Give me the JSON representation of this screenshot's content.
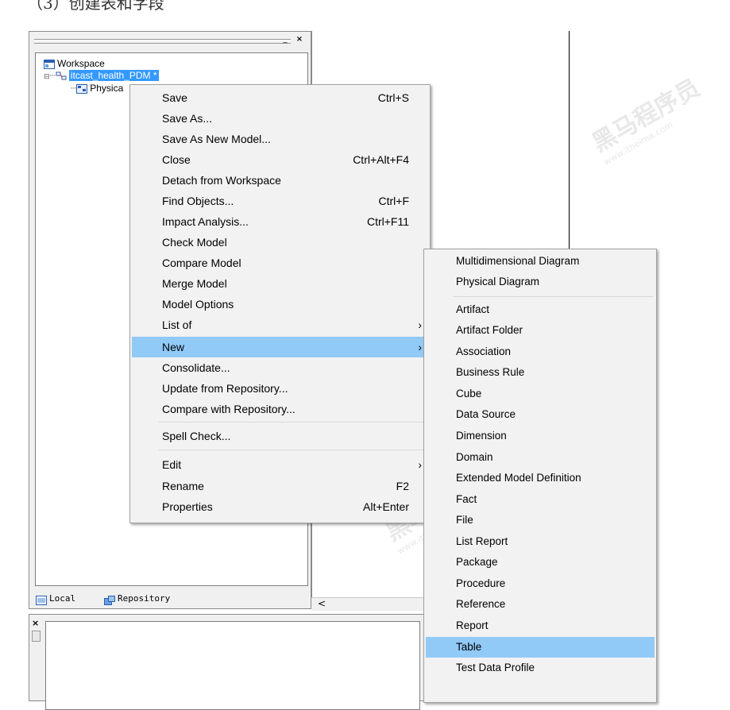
{
  "caption": "（3）创建表和字段",
  "panel": {
    "min_btn": "_",
    "max_btn": "▫",
    "close_btn": "×",
    "tree": {
      "root": "Workspace",
      "model": "itcast_health_PDM *",
      "child": "Physica"
    },
    "tabs": [
      {
        "label": "Local"
      },
      {
        "label": "Repository"
      }
    ]
  },
  "canvas": {
    "scroll_left": "<"
  },
  "output_close": "×",
  "context_menu": {
    "items": [
      {
        "label": "Save",
        "shortcut": "Ctrl+S"
      },
      {
        "label": "Save As...",
        "shortcut": ""
      },
      {
        "label": "Save As New Model...",
        "shortcut": ""
      },
      {
        "label": "Close",
        "shortcut": "Ctrl+Alt+F4"
      },
      {
        "label": "Detach from Workspace",
        "shortcut": ""
      },
      {
        "label": "Find Objects...",
        "shortcut": "Ctrl+F"
      },
      {
        "label": "Impact Analysis...",
        "shortcut": "Ctrl+F11"
      },
      {
        "label": "Check Model",
        "shortcut": ""
      },
      {
        "label": "Compare Model",
        "shortcut": ""
      },
      {
        "label": "Merge Model",
        "shortcut": ""
      },
      {
        "label": "Model Options",
        "shortcut": ""
      },
      {
        "label": "List of",
        "shortcut": "",
        "submenu": true
      },
      {
        "label": "New",
        "shortcut": "",
        "submenu": true,
        "highlighted": true
      },
      {
        "label": "Consolidate...",
        "shortcut": ""
      },
      {
        "label": "Update from Repository...",
        "shortcut": ""
      },
      {
        "label": "Compare with Repository...",
        "shortcut": ""
      },
      {
        "label": "Spell Check...",
        "shortcut": ""
      },
      {
        "label": "Edit",
        "shortcut": "",
        "submenu": true
      },
      {
        "label": "Rename",
        "shortcut": "F2"
      },
      {
        "label": "Properties",
        "shortcut": "Alt+Enter"
      }
    ]
  },
  "new_submenu": {
    "items": [
      {
        "label": "Multidimensional Diagram"
      },
      {
        "label": "Physical Diagram"
      },
      {
        "label": "Artifact"
      },
      {
        "label": "Artifact Folder"
      },
      {
        "label": "Association"
      },
      {
        "label": "Business Rule"
      },
      {
        "label": "Cube"
      },
      {
        "label": "Data Source"
      },
      {
        "label": "Dimension"
      },
      {
        "label": "Domain"
      },
      {
        "label": "Extended Model Definition"
      },
      {
        "label": "Fact"
      },
      {
        "label": "File"
      },
      {
        "label": "List Report"
      },
      {
        "label": "Package"
      },
      {
        "label": "Procedure"
      },
      {
        "label": "Reference"
      },
      {
        "label": "Report"
      },
      {
        "label": "Table",
        "highlighted": true
      },
      {
        "label": "Test Data Profile"
      }
    ]
  },
  "watermark": {
    "brand": "黑马程序员",
    "url": "www.itheima.com"
  },
  "colors": {
    "menu_highlight": "#91c9f7",
    "tree_selection": "#3399ff",
    "panel_bg": "#f0f0f0"
  }
}
